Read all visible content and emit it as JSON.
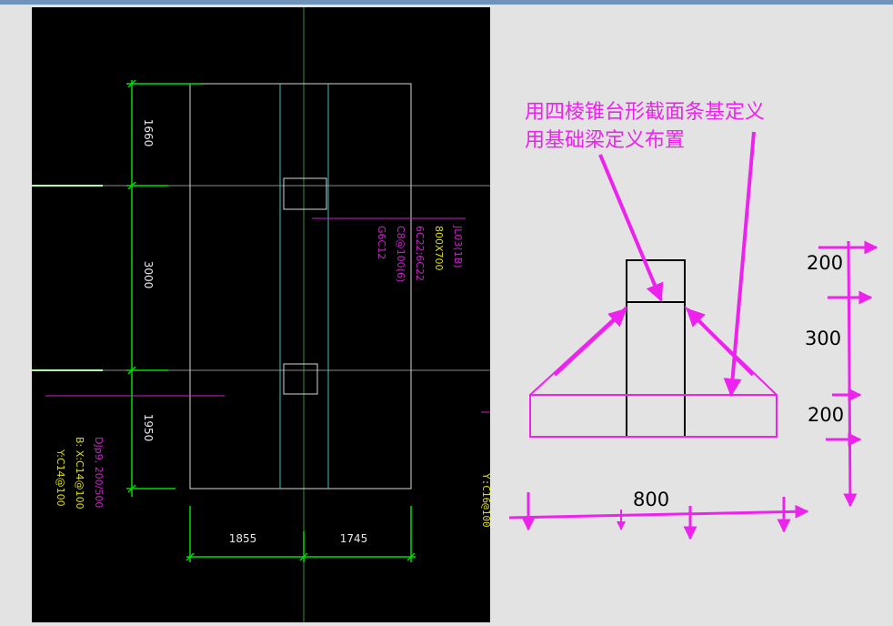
{
  "cad_drawing": {
    "vertical_dims": [
      "1660",
      "3000",
      "1950"
    ],
    "horizontal_dims": [
      "1855",
      "1745"
    ],
    "beam_label": [
      "JL03(1B)",
      "800X700",
      "6C22;6C22",
      "C8@100(6)",
      "G6C12"
    ],
    "footing_label": [
      "DJp9, 200/500",
      "B: X:C14@100",
      "Y:C14@100"
    ],
    "right_edge_label": "Y:C16@100"
  },
  "annotation": {
    "note_line1": "用四棱锥台形截面条基定义",
    "note_line2": "用基础梁定义布置",
    "dim_200_top": "200",
    "dim_300": "300",
    "dim_200_bottom": "200",
    "dim_800": "800"
  },
  "colors": {
    "magenta": "#ee22ee",
    "cad_green": "#00dd00",
    "cad_yellow": "#e0e000",
    "cad_cyan": "#40c0c0"
  }
}
